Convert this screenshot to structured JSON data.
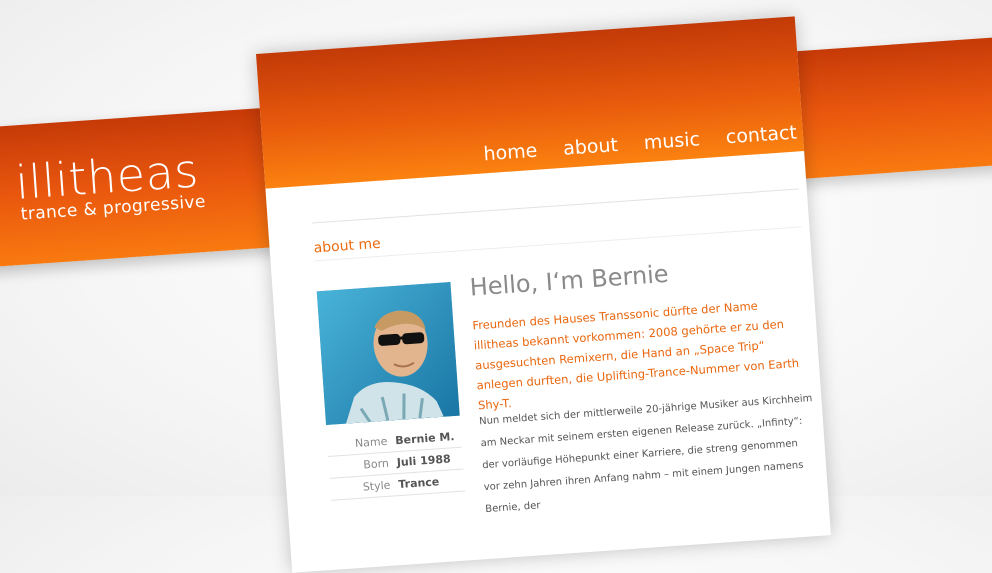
{
  "logo": {
    "name": "illitheas",
    "tagline": "trance & progressive"
  },
  "nav": {
    "items": [
      "home",
      "about",
      "music",
      "contact"
    ]
  },
  "section": {
    "title": "about me"
  },
  "headline": "Hello, I‘m Bernie",
  "intro": "Freunden des Hauses Transsonic dürfte der Name illitheas bekannt vorkommen: 2008 gehörte er zu den ausgesuchten Remixern, die Hand an „Space Trip“ anlegen durften, die Uplifting-Trance-Nummer von Earth Shy-T.",
  "body": "Nun meldet sich der mittlerweile 20-jährige Musiker aus Kirchheim am Neckar mit seinem ersten eigenen Release zurück. „Infinty“: der vorläufige Höhepunkt einer Karriere, die streng genommen vor zehn Jahren ihren Anfang nahm – mit einem Jungen namens Bernie, der",
  "profile": [
    {
      "label": "Name",
      "value": "Bernie M."
    },
    {
      "label": "Born",
      "value": "Juli 1988"
    },
    {
      "label": "Style",
      "value": "Trance"
    }
  ],
  "colors": {
    "accent": "#ea6b10",
    "header_dark": "#c23a08",
    "header_light": "#fb8210"
  }
}
